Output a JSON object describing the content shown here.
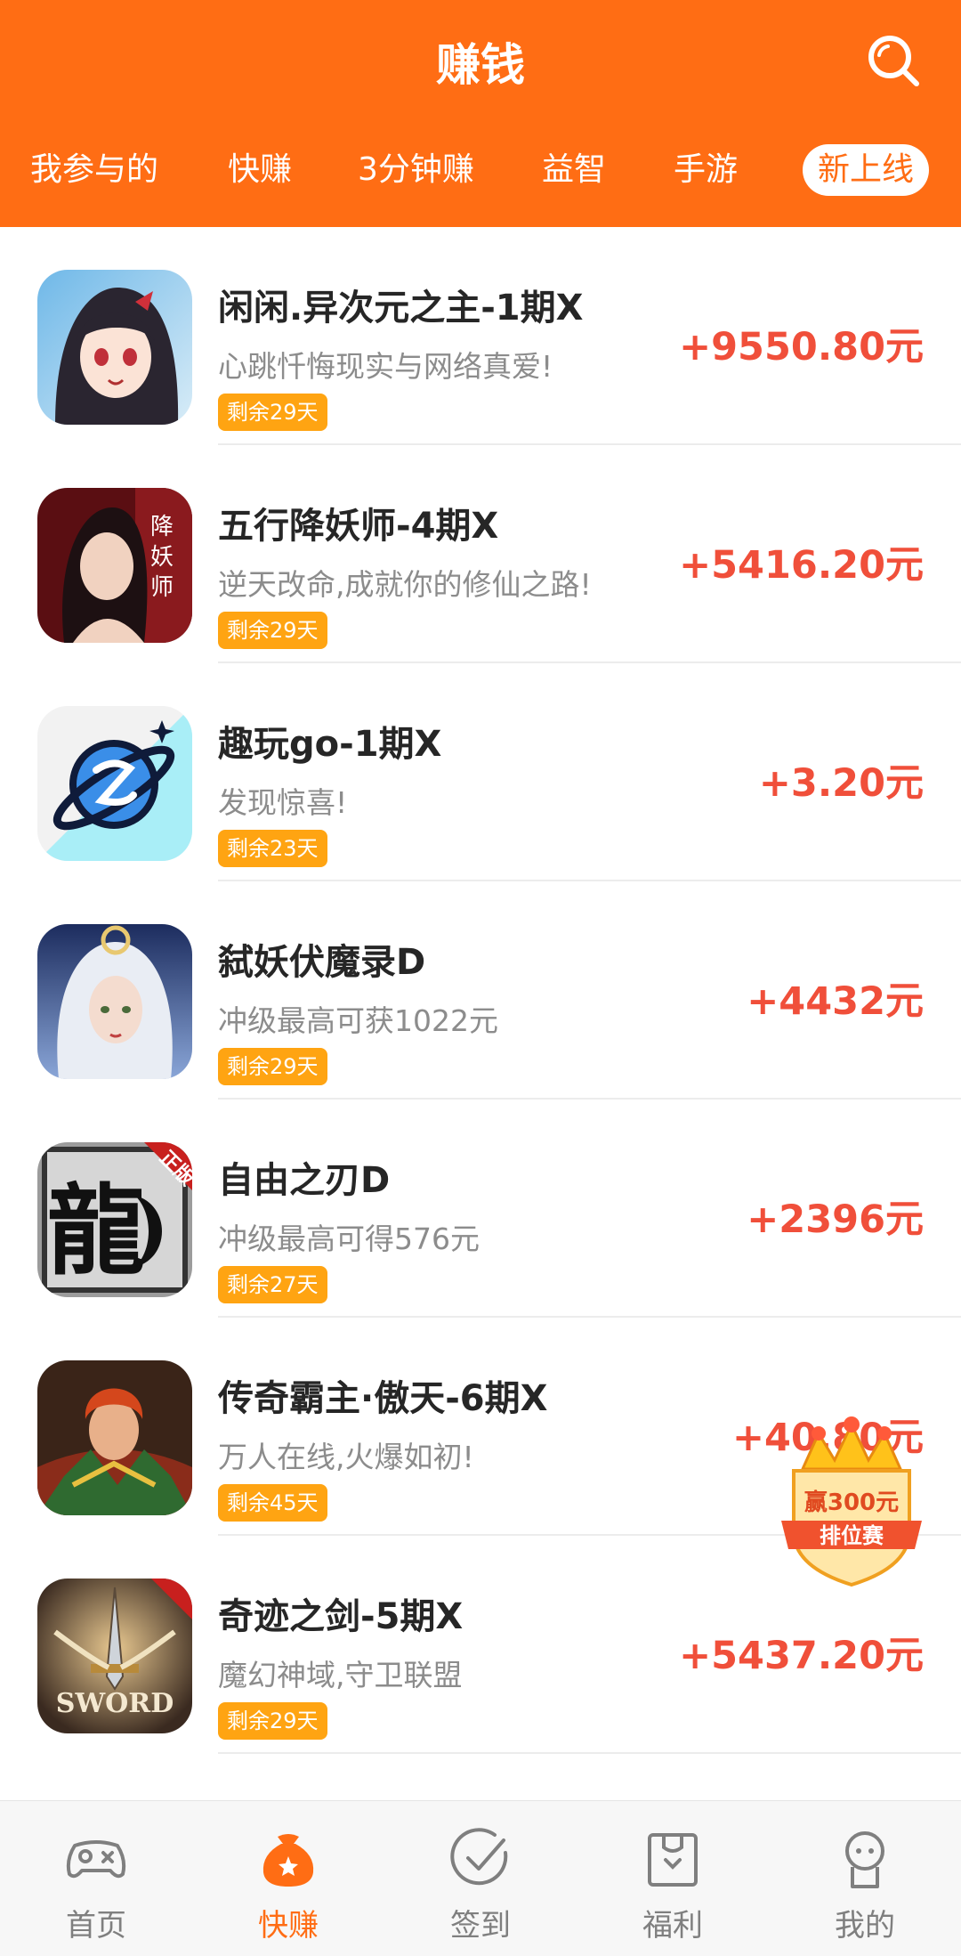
{
  "header": {
    "title": "赚钱",
    "search_icon": "search-icon",
    "tabs": [
      {
        "label": "我参与的"
      },
      {
        "label": "快赚"
      },
      {
        "label": "3分钟赚"
      },
      {
        "label": "益智"
      },
      {
        "label": "手游"
      },
      {
        "label": "新上线",
        "active": true
      }
    ]
  },
  "colors": {
    "accent": "#ff6d14",
    "reward": "#f04f3a",
    "badge": "#ffa412"
  },
  "games": [
    {
      "name": "闲闲.异次元之主-1期X",
      "desc": "心跳忏悔现实与网络真爱!",
      "days_left": "剩余29天",
      "reward": "+9550.80元",
      "icon": "anime-girl-game-icon"
    },
    {
      "name": "五行降妖师-4期X",
      "desc": "逆天改命,成就你的修仙之路!",
      "days_left": "剩余29天",
      "reward": "+5416.20元",
      "icon": "xianxia-woman-game-icon"
    },
    {
      "name": "趣玩go-1期X",
      "desc": "发现惊喜!",
      "days_left": "剩余23天",
      "reward": "+3.20元",
      "icon": "blue-planet-app-icon"
    },
    {
      "name": "弑妖伏魔录D",
      "desc": "冲级最高可获1022元",
      "days_left": "剩余29天",
      "reward": "+4432元",
      "icon": "white-hair-warrior-game-icon"
    },
    {
      "name": "自由之刃D",
      "desc": "冲级最高可得576元",
      "days_left": "剩余27天",
      "reward": "+2396元",
      "icon": "dragon-calligraphy-game-icon"
    },
    {
      "name": "传奇霸主·傲天-6期X",
      "desc": "万人在线,火爆如初!",
      "days_left": "剩余45天",
      "reward": "+40.80元",
      "icon": "red-hair-warrior-game-icon"
    },
    {
      "name": "奇迹之剑-5期X",
      "desc": "魔幻神域,守卫联盟",
      "days_left": "剩余29天",
      "reward": "+5437.20元",
      "icon": "sword-game-icon"
    }
  ],
  "float_ad": {
    "line1": "赢300元",
    "line2": "排位赛",
    "icon": "crown-icon"
  },
  "bottom_nav": [
    {
      "label": "首页",
      "icon": "gamepad-icon"
    },
    {
      "label": "快赚",
      "icon": "money-bag-icon",
      "active": true
    },
    {
      "label": "签到",
      "icon": "check-circle-icon"
    },
    {
      "label": "福利",
      "icon": "gift-box-icon"
    },
    {
      "label": "我的",
      "icon": "profile-icon"
    }
  ]
}
